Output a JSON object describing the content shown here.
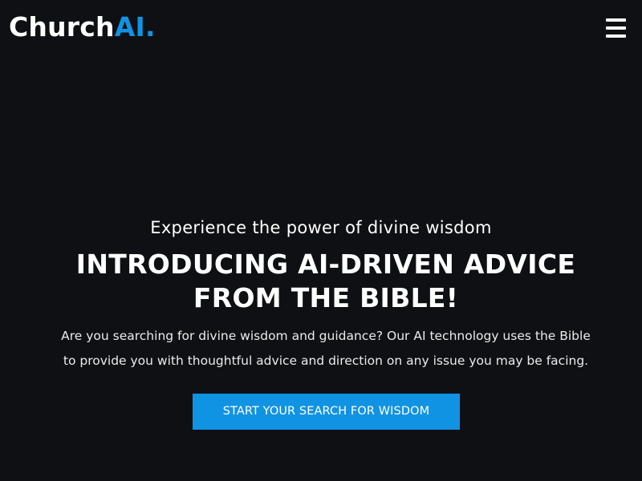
{
  "header": {
    "logo_text": "Church",
    "logo_accent": "AI.",
    "menu_icon": "hamburger-menu-icon"
  },
  "hero": {
    "subtitle": "Experience the power of divine wisdom",
    "headline": "INTRODUCING AI-DRIVEN ADVICE FROM THE BIBLE!",
    "description": "Are you searching for divine wisdom and guidance? Our AI technology uses the Bible to provide you with thoughtful advice and direction on any issue you may be facing.",
    "cta_label": "START YOUR SEARCH FOR WISDOM"
  },
  "colors": {
    "background": "#0f1013",
    "accent": "#1193e3",
    "text": "#ffffff"
  }
}
